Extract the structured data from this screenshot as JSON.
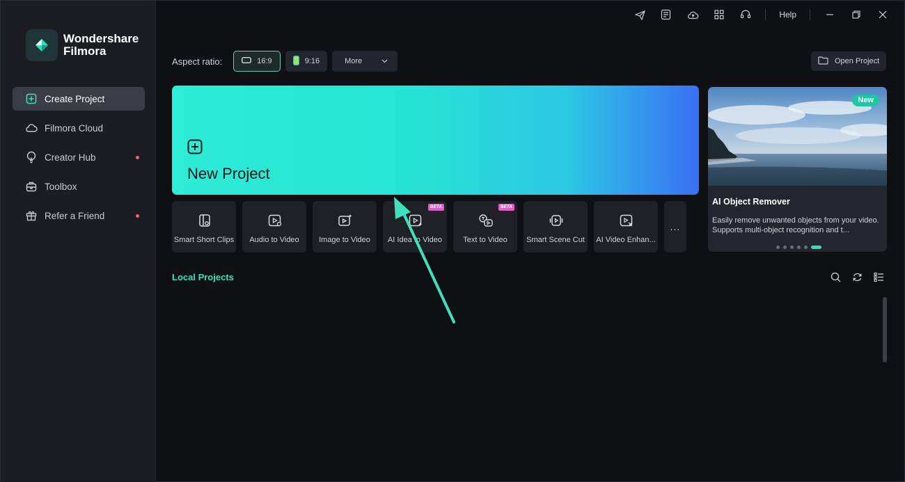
{
  "app": {
    "name_line1": "Wondershare",
    "name_line2": "Filmora"
  },
  "sidebar": {
    "items": [
      {
        "label": "Create Project",
        "icon": "plus-square-icon",
        "active": true,
        "dot": false
      },
      {
        "label": "Filmora Cloud",
        "icon": "cloud-icon",
        "active": false,
        "dot": false
      },
      {
        "label": "Creator Hub",
        "icon": "bulb-icon",
        "active": false,
        "dot": true
      },
      {
        "label": "Toolbox",
        "icon": "toolbox-icon",
        "active": false,
        "dot": false
      },
      {
        "label": "Refer a Friend",
        "icon": "gift-icon",
        "active": false,
        "dot": true
      }
    ]
  },
  "titlebar": {
    "help_label": "Help",
    "icons": [
      "send-icon",
      "notes-icon",
      "cloud-upload-icon",
      "apps-grid-icon",
      "headset-icon"
    ]
  },
  "aspect": {
    "label": "Aspect ratio:",
    "options": [
      {
        "label": "16:9",
        "active": true
      },
      {
        "label": "9:16",
        "active": false
      }
    ],
    "more_label": "More"
  },
  "open_project_label": "Open Project",
  "hero": {
    "title": "New Project"
  },
  "tools": [
    {
      "label": "Smart Short Clips",
      "icon": "smart-short-clips-icon",
      "beta": false
    },
    {
      "label": "Audio to Video",
      "icon": "audio-to-video-icon",
      "beta": false
    },
    {
      "label": "Image to Video",
      "icon": "image-to-video-icon",
      "beta": false
    },
    {
      "label": "AI Idea to Video",
      "icon": "ai-idea-to-video-icon",
      "beta": true
    },
    {
      "label": "Text to Video",
      "icon": "text-to-video-icon",
      "beta": true
    },
    {
      "label": "Smart Scene Cut",
      "icon": "smart-scene-cut-icon",
      "beta": false
    },
    {
      "label": "AI Video Enhan...",
      "icon": "ai-video-enhancer-icon",
      "beta": false
    }
  ],
  "beta_label": "BETA",
  "more_tools_label": "...",
  "feature": {
    "badge": "New",
    "title": "AI Object Remover",
    "description": "Easily remove unwanted objects from your video. Supports multi-object recognition and t...",
    "page_count": 6,
    "active_page": 6
  },
  "local_projects": {
    "title": "Local Projects"
  },
  "colors": {
    "accent": "#2ee0bf",
    "sidebar_bg": "#1a1d22",
    "main_bg": "#0e1014",
    "beta": "#e55acf",
    "notification_dot": "#ff5a6e"
  }
}
